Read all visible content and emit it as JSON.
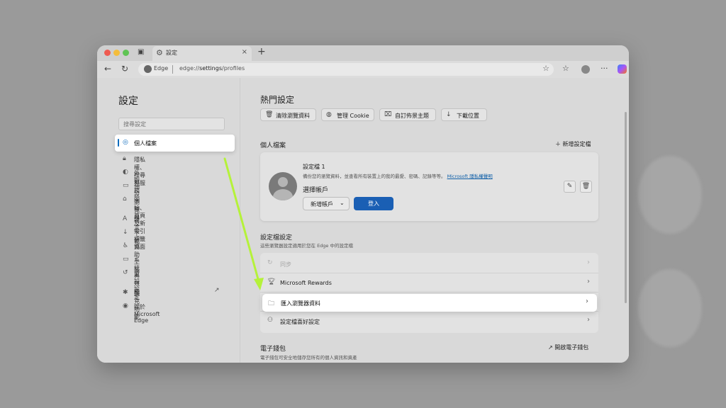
{
  "browser": {
    "tab_title": "設定",
    "brand": "Edge",
    "url_prefix": "edge://",
    "url_bold": "settings",
    "url_suffix": "/profiles"
  },
  "sidebar": {
    "title": "設定",
    "search_placeholder": "搜尋設定",
    "active_item": "個人檔案",
    "items": [
      "隱私權、搜尋與服務",
      "外觀",
      "預設瀏覽器",
      "開始、首頁及新索引標籤頁面",
      "語言",
      "下載",
      "協助工具",
      "系統與效能",
      "重設設定",
      "擴充功能",
      "關於 Microsoft Edge"
    ]
  },
  "quick": {
    "title": "熱門設定",
    "chips": [
      "清除瀏覽資料",
      "管理 Cookie",
      "自訂佈景主題",
      "下載位置"
    ]
  },
  "profile": {
    "section_title": "個人檔案",
    "add_label": "新增設定檔",
    "name": "設定檔 1",
    "desc": "備份您的瀏覽資料，並查看所有裝置上的我的最愛、密碼、記錄等等。",
    "privacy_link": "Microsoft 隱私權聲明",
    "choose_account": "選擇帳戶",
    "add_account": "新增帳戶",
    "sign_in": "登入"
  },
  "profile_settings": {
    "title": "設定檔設定",
    "subtitle": "這些瀏覽器設定適用於您在 Edge 中的設定檔",
    "rows": [
      "同步",
      "Microsoft Rewards",
      "匯入瀏覽器資料",
      "設定檔喜好設定"
    ]
  },
  "wallet": {
    "title": "電子錢包",
    "subtitle": "電子錢包可安全地儲存您所有的個人資訊和資產",
    "open_label": "開啟電子錢包"
  },
  "colors": {
    "accent": "#0f6cbd",
    "arrow": "#b5f23a",
    "signin": "#1a5fb4"
  }
}
